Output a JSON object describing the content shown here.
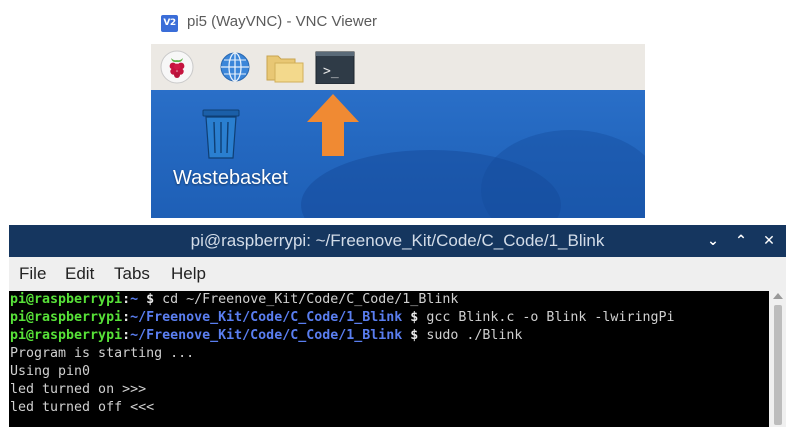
{
  "vnc": {
    "logo_text": "V2",
    "title": "pi5 (WayVNC) - VNC Viewer",
    "taskbar": {
      "icons": [
        "raspberry-menu-icon",
        "web-browser-icon",
        "file-manager-icon",
        "terminal-icon"
      ],
      "terminal_glyph": ">_"
    },
    "desktop": {
      "wastebasket_label": "Wastebasket",
      "arrow_color": "#f08a33"
    }
  },
  "terminal": {
    "title_user": "pi@raspberrypi",
    "title_path": ": ~/Freenove_Kit/Code/C_Code/1_Blink",
    "controls": {
      "minimize": "⌄",
      "maximize": "⌃",
      "close": "✕"
    },
    "menu": [
      "File",
      "Edit",
      "Tabs",
      "Help"
    ],
    "lines": [
      {
        "user": "pi@raspberrypi",
        "sep": ":",
        "path": "~",
        "prompt": " $ ",
        "cmd": "cd ~/Freenove_Kit/Code/C_Code/1_Blink"
      },
      {
        "user": "pi@raspberrypi",
        "sep": ":",
        "path": "~/Freenove_Kit/Code/C_Code/1_Blink",
        "prompt": " $ ",
        "cmd": "gcc Blink.c -o Blink -lwiringPi"
      },
      {
        "user": "pi@raspberrypi",
        "sep": ":",
        "path": "~/Freenove_Kit/Code/C_Code/1_Blink",
        "prompt": " $ ",
        "cmd": "sudo ./Blink"
      },
      {
        "text": "Program is starting ..."
      },
      {
        "text": "Using pin0"
      },
      {
        "text": "led turned on >>>"
      },
      {
        "text": "led turned off <<<"
      }
    ]
  },
  "colors": {
    "terminal_titlebar": "#15365f",
    "prompt_user": "#57e138",
    "prompt_path": "#5a7ef0",
    "desktop_blue": "#2468c0"
  }
}
